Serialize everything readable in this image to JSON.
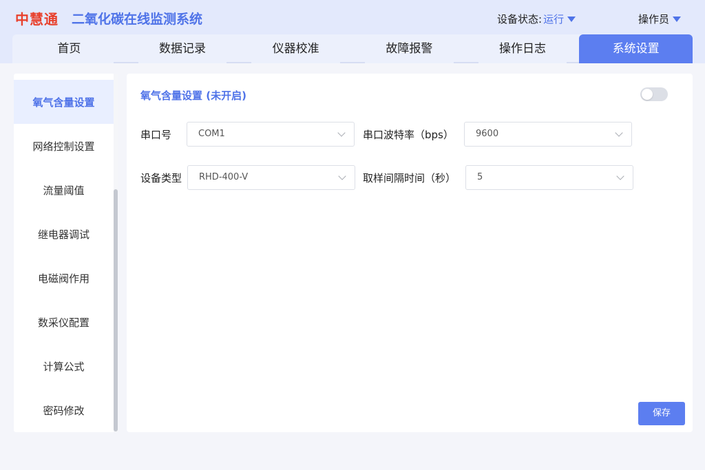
{
  "header": {
    "brand": "中慧通",
    "app_title": "二氧化碳在线监测系统",
    "status_label": "设备状态:",
    "status_value": "运行",
    "operator": "操作员",
    "accent_color": "#5c7ef0",
    "brand_color": "#e8402c"
  },
  "tabs": [
    {
      "label": "首页",
      "active": false
    },
    {
      "label": "数据记录",
      "active": false
    },
    {
      "label": "仪器校准",
      "active": false
    },
    {
      "label": "故障报警",
      "active": false
    },
    {
      "label": "操作日志",
      "active": false
    },
    {
      "label": "系统设置",
      "active": true
    }
  ],
  "sidebar": {
    "items": [
      {
        "label": "氧气含量设置",
        "active": true
      },
      {
        "label": "网络控制设置",
        "active": false
      },
      {
        "label": "流量阈值",
        "active": false
      },
      {
        "label": "继电器调试",
        "active": false
      },
      {
        "label": "电磁阀作用",
        "active": false
      },
      {
        "label": "数采仪配置",
        "active": false
      },
      {
        "label": "计算公式",
        "active": false
      },
      {
        "label": "密码修改",
        "active": false
      }
    ]
  },
  "main": {
    "title": "氧气含量设置 (未开启)",
    "toggle_on": false,
    "fields": {
      "serial_port": {
        "label": "串口号",
        "value": "COM1"
      },
      "baud_rate": {
        "label": "串口波特率（bps）",
        "value": "9600"
      },
      "device_type": {
        "label": "设备类型",
        "value": "RHD-400-V"
      },
      "sample_interval": {
        "label": "取样间隔时间（秒）",
        "value": "5"
      }
    },
    "save_label": "保存"
  }
}
